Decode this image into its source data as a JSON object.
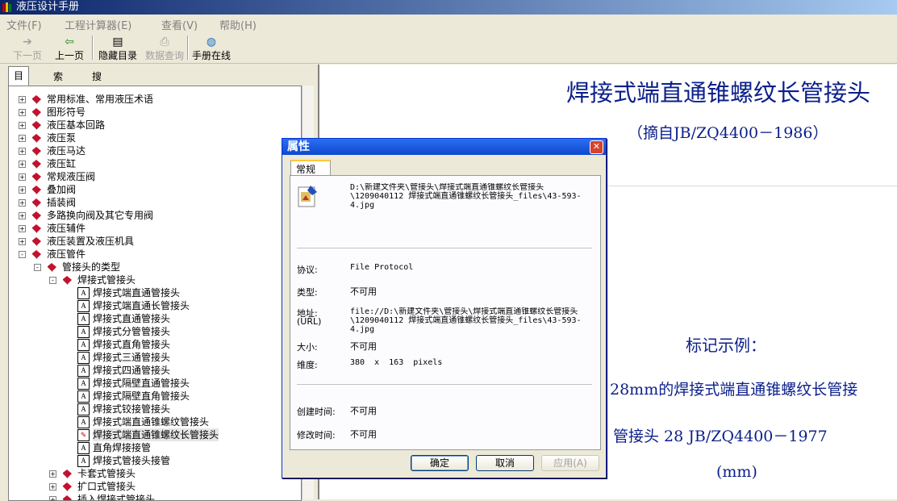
{
  "app": {
    "title": "液压设计手册"
  },
  "menu": [
    "文件(F)",
    "工程计算器(E)",
    "查看(V)",
    "帮助(H)"
  ],
  "toolbar": {
    "next": "下一页",
    "prev": "上一页",
    "hide_toc": "隐藏目录",
    "data_query": "数据查询",
    "online": "手册在线"
  },
  "tabs": [
    "目录",
    "索引",
    "搜索"
  ],
  "tree": [
    {
      "label": "常用标准、常用液压术语"
    },
    {
      "label": "图形符号"
    },
    {
      "label": "液压基本回路"
    },
    {
      "label": "液压泵"
    },
    {
      "label": "液压马达"
    },
    {
      "label": "液压缸"
    },
    {
      "label": "常规液压阀"
    },
    {
      "label": "叠加阀"
    },
    {
      "label": "插装阀"
    },
    {
      "label": "多路换向阀及其它专用阀"
    },
    {
      "label": "液压辅件"
    },
    {
      "label": "液压装置及液压机具"
    },
    {
      "label": "液压管件"
    },
    {
      "label": "管接头的类型"
    },
    {
      "label": "焊接式管接头"
    },
    {
      "label": "焊接式端直通管接头"
    },
    {
      "label": "焊接式端直通长管接头"
    },
    {
      "label": "焊接式直通管接头"
    },
    {
      "label": "焊接式分管管接头"
    },
    {
      "label": "焊接式直角管接头"
    },
    {
      "label": "焊接式三通管接头"
    },
    {
      "label": "焊接式四通管接头"
    },
    {
      "label": "焊接式隔壁直通管接头"
    },
    {
      "label": "焊接式隔壁直角管接头"
    },
    {
      "label": "焊接式铰接管接头"
    },
    {
      "label": "焊接式端直通锥螺纹管接头"
    },
    {
      "label": "焊接式端直通锥螺纹长管接头"
    },
    {
      "label": "直角焊接接管"
    },
    {
      "label": "焊接式管接头接管"
    },
    {
      "label": "卡套式管接头"
    },
    {
      "label": "扩口式管接头"
    },
    {
      "label": "插入焊接式管接头"
    }
  ],
  "content": {
    "title": "焊接式端直通锥螺纹长管接头",
    "subtitle": "（摘自JB/ZQ4400－1986）",
    "mark_heading": "标记示例：",
    "line1": "28mm的焊接式端直通锥螺纹长管接",
    "line2": "管接头 28 JB/ZQ4400－1977",
    "unit": "(mm)"
  },
  "dialog": {
    "title": "属性",
    "tab": "常规",
    "path": "D:\\新建文件夹\\管接头\\焊接式端直通锥螺纹长管接头\\1209040112 焊接式端直通锥螺纹长管接头_files\\43-593-4.jpg",
    "protocol_label": "协议:",
    "protocol_value": "File Protocol",
    "type_label": "类型:",
    "type_value": "不可用",
    "url_label": "地址:",
    "url_label2": "(URL)",
    "url_value": "file://D:\\新建文件夹\\管接头\\焊接式端直通锥螺纹长管接头\\1209040112 焊接式端直通锥螺纹长管接头_files\\43-593-4.jpg",
    "size_label": "大小:",
    "size_value": "不可用",
    "dim_label": "维度:",
    "dim_value": "380  x  163  pixels",
    "created_label": "创建时间:",
    "created_value": "不可用",
    "modified_label": "修改时间:",
    "modified_value": "不可用",
    "ok": "确定",
    "cancel": "取消",
    "apply": "应用(A)"
  }
}
